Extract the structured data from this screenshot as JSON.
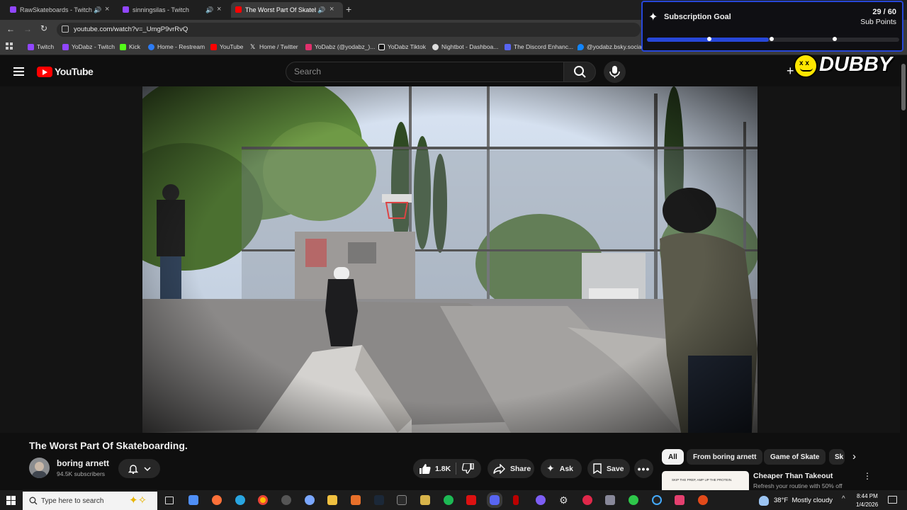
{
  "browser": {
    "tabs": [
      {
        "title": "RawSkateboards - Twitch",
        "favicon_color": "#9146ff"
      },
      {
        "title": "sinningsilas - Twitch",
        "favicon_color": "#9146ff"
      },
      {
        "title": "The Worst Part Of Skatebo",
        "favicon_color": "#ff0000",
        "active": true
      }
    ],
    "new_tab_icon": "plus-icon",
    "url": "youtube.com/watch?v=_UmgP9vrRvQ",
    "bookmarks": [
      {
        "label": "Twitch",
        "color": "#9146ff"
      },
      {
        "label": "YoDabz - Twitch",
        "color": "#9146ff"
      },
      {
        "label": "Kick",
        "color": "#53fc18"
      },
      {
        "label": "Home - Restream",
        "color": "#2c7cf6"
      },
      {
        "label": "YouTube",
        "color": "#ff0000"
      },
      {
        "label": "Home / Twitter",
        "color": "#ffffff"
      },
      {
        "label": "YoDabz (@yodabz_)...",
        "color": "#e1306c"
      },
      {
        "label": "YoDabz Tiktok",
        "color": "#ffffff"
      },
      {
        "label": "Nightbot - Dashboa...",
        "color": "#dddddd"
      },
      {
        "label": "The Discord Enhanc...",
        "color": "#5865f2"
      },
      {
        "label": "@yodabz.bsky.socia...",
        "color": "#1185fe"
      }
    ]
  },
  "overlay": {
    "title": "Subscription Goal",
    "count": "29 / 60",
    "unit": "Sub Points",
    "progress": 0.483,
    "brand": "DUBBY",
    "accent": "#2747d8"
  },
  "youtube": {
    "logo": "YouTube",
    "search_placeholder": "Search"
  },
  "video": {
    "title": "The Worst Part Of Skateboarding.",
    "channel": "boring arnett",
    "subscribers": "94.5K subscribers",
    "likes": "1.8K",
    "share": "Share",
    "ask": "Ask",
    "save": "Save"
  },
  "chips": [
    "All",
    "From boring arnett",
    "Game of Skate",
    "Sk"
  ],
  "recommendation": {
    "title": "Cheaper Than Takeout",
    "subtitle": "Refresh your routine with 50% off",
    "thumb_text": "SKIP THE PREP, AMP UP THE PROTEIN."
  },
  "taskbar": {
    "search_placeholder": "Type here to search",
    "weather": "38°F  Mostly cloudy",
    "time": "8:44 PM",
    "date": "1/4/2026"
  }
}
